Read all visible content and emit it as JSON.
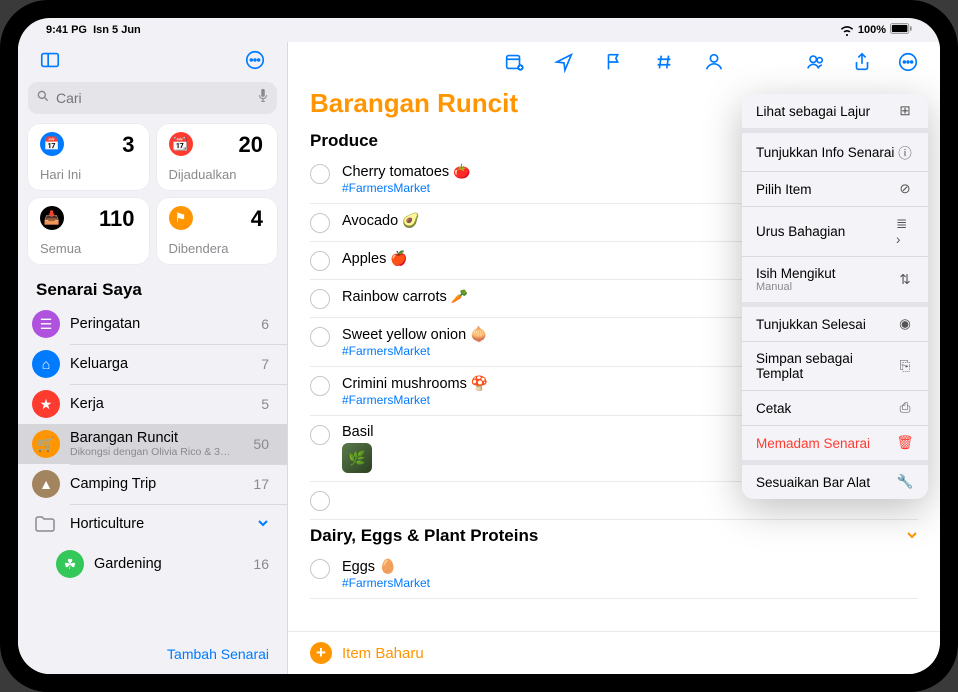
{
  "statusbar": {
    "time": "9:41 PG",
    "date": "Isn 5 Jun",
    "battery": "100%"
  },
  "sidebar": {
    "search_placeholder": "Cari",
    "tiles": [
      {
        "label": "Hari Ini",
        "count": "3",
        "color": "#007aff",
        "glyph": "📅"
      },
      {
        "label": "Dijadualkan",
        "count": "20",
        "color": "#ff3b30",
        "glyph": "📆"
      },
      {
        "label": "Semua",
        "count": "110",
        "color": "#000000",
        "glyph": "📥"
      },
      {
        "label": "Dibendera",
        "count": "4",
        "color": "#ff9500",
        "glyph": "⚑"
      }
    ],
    "my_lists_header": "Senarai Saya",
    "lists": [
      {
        "label": "Peringatan",
        "count": "6",
        "color": "#af52de",
        "glyph": "☰"
      },
      {
        "label": "Keluarga",
        "count": "7",
        "color": "#007aff",
        "glyph": "⌂"
      },
      {
        "label": "Kerja",
        "count": "5",
        "color": "#ff3b30",
        "glyph": "★"
      },
      {
        "label": "Barangan Runcit",
        "sub": "Dikongsi dengan Olivia Rico & 3…",
        "count": "50",
        "color": "#ff9500",
        "glyph": "🛒",
        "selected": true
      },
      {
        "label": "Camping Trip",
        "count": "17",
        "color": "#a2845e",
        "glyph": "▲"
      }
    ],
    "folder": {
      "label": "Horticulture"
    },
    "child": {
      "label": "Gardening",
      "count": "16",
      "color": "#34c759",
      "glyph": "☘︎"
    },
    "add_list": "Tambah Senarai"
  },
  "main": {
    "title": "Barangan Runcit",
    "sections": [
      {
        "name": "Produce",
        "items": [
          {
            "title": "Cherry tomatoes",
            "emoji": "🍅",
            "tag": "#FarmersMarket"
          },
          {
            "title": "Avocado",
            "emoji": "🥑"
          },
          {
            "title": "Apples",
            "emoji": "🍎"
          },
          {
            "title": "Rainbow carrots",
            "emoji": "🥕"
          },
          {
            "title": "Sweet yellow onion",
            "emoji": "🧅",
            "tag": "#FarmersMarket"
          },
          {
            "title": "Crimini mushrooms",
            "emoji": "🍄",
            "tag": "#FarmersMarket"
          },
          {
            "title": "Basil",
            "thumb": true
          }
        ]
      },
      {
        "name": "Dairy, Eggs & Plant Proteins",
        "collapsible": true,
        "items": [
          {
            "title": "Eggs",
            "emoji": "🥚",
            "tag": "#FarmersMarket"
          }
        ]
      }
    ],
    "new_item": "Item Baharu"
  },
  "popover": {
    "items": [
      {
        "label": "Lihat sebagai Lajur",
        "icon": "⊞",
        "sep": true
      },
      {
        "label": "Tunjukkan Info Senarai",
        "icon": "ⓘ"
      },
      {
        "label": "Pilih Item",
        "icon": "⊘"
      },
      {
        "label": "Urus Bahagian",
        "icon": "≣",
        "chevron": true
      },
      {
        "label": "Isih Mengikut",
        "sub": "Manual",
        "icon": "⇅",
        "sep": true
      },
      {
        "label": "Tunjukkan Selesai",
        "icon": "◉"
      },
      {
        "label": "Simpan sebagai Templat",
        "icon": "⎘"
      },
      {
        "label": "Cetak",
        "icon": "⎙"
      },
      {
        "label": "Memadam Senarai",
        "icon": "🗑",
        "danger": true,
        "sep": true
      },
      {
        "label": "Sesuaikan Bar Alat",
        "icon": "🔧"
      }
    ]
  }
}
